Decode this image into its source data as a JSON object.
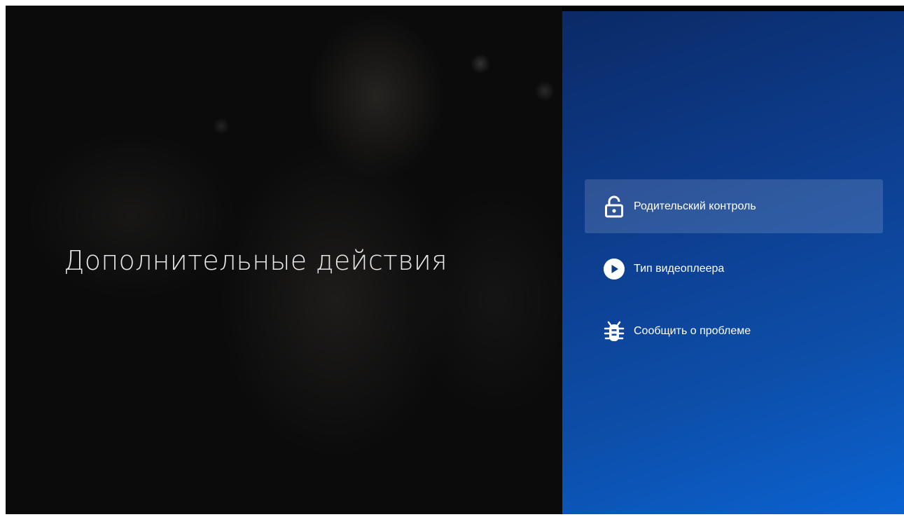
{
  "screen": {
    "heading": "Дополнительные действия"
  },
  "menu": {
    "items": [
      {
        "label": "Родительский контроль",
        "icon": "lock-open-icon",
        "selected": true
      },
      {
        "label": "Тип видеоплеера",
        "icon": "play-circle-icon",
        "selected": false
      },
      {
        "label": "Сообщить о проблеме",
        "icon": "bug-icon",
        "selected": false
      }
    ]
  },
  "colors": {
    "panel_top": "#0b2a66",
    "panel_bottom": "#0a63d2",
    "text": "#ffffff"
  }
}
